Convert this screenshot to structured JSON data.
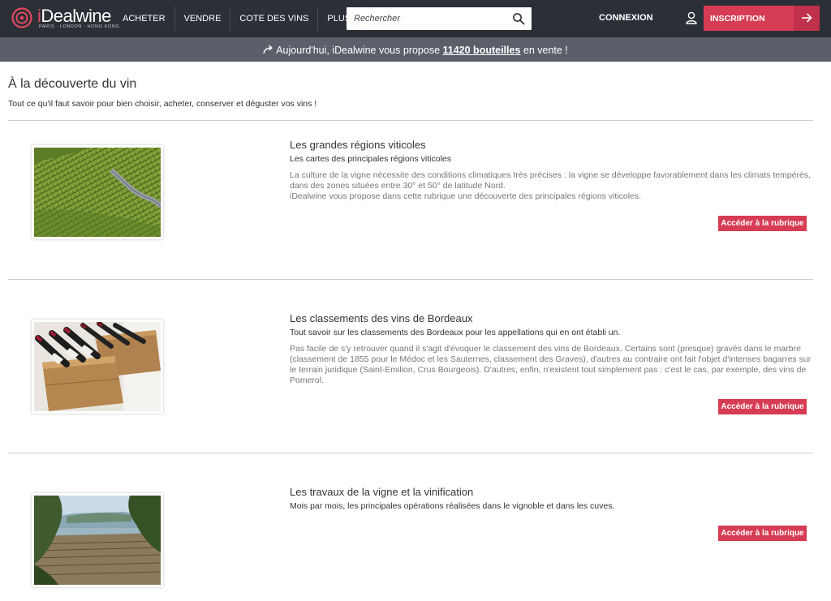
{
  "header": {
    "logo": {
      "brand_prefix": "i",
      "brand_main": "Dealwine",
      "tagline": "PARIS · LONDON · HONG KONG"
    },
    "nav": [
      {
        "label": "ACHETER"
      },
      {
        "label": "VENDRE"
      },
      {
        "label": "COTE DES VINS"
      },
      {
        "label": "PLUS..."
      }
    ],
    "search": {
      "placeholder": "Rechercher",
      "icon": "search-icon"
    },
    "connexion_label": "CONNEXION",
    "user_icon": "user-icon",
    "inscription_label": "INSCRIPTION",
    "inscription_icon": "arrow-right-icon"
  },
  "banner": {
    "prefix": "Aujourd'hui, iDealwine vous propose ",
    "count": "11420 bouteilles",
    "suffix": " en vente !"
  },
  "page": {
    "title": "À la découverte du vin",
    "subtitle": "Tout ce qu'il faut savoir pour bien choisir, acheter, conserver et déguster vos vins !"
  },
  "sections": [
    {
      "title": "Les grandes régions viticoles",
      "subtitle": "Les cartes des principales régions viticoles",
      "body": [
        "La culture de la vigne nécessite des conditions climatiques très précises : la vigne se développe favorablement dans les climats tempérés, dans des zones situées entre 30° et 50° de latitude Nord.",
        "iDealwine vous propose dans cette rubrique une découverte des principales régions viticoles."
      ],
      "button": "Accéder à la rubrique"
    },
    {
      "title": "Les classements des vins de Bordeaux",
      "subtitle": "Tout savoir sur les classements des Bordeaux pour les appellations qui en ont établi un.",
      "body": [
        "Pas facile de s'y retrouver quand il s'agit d'évoquer le classement des vins de Bordeaux. Certains sont (presque) gravés dans le marbre (classement de 1855 pour le Médoc et les Sauternes, classement des Graves), d'autres au contraire ont fait l'objet d'intenses bagarres sur le terrain juridique (Saint-Emilion, Crus Bourgeois). D'autres, enfin, n'existent tout simplement pas : c'est le cas, par exemple, des vins de Pomerol."
      ],
      "button": "Accéder à la rubrique"
    },
    {
      "title": "Les travaux de la vigne et la vinification",
      "subtitle": "Mois par mois, les principales opérations réalisées dans le vignoble et dans les cuves.",
      "body": [],
      "button": "Accéder à la rubrique"
    }
  ],
  "colors": {
    "header_bg": "#2b2f36",
    "banner_bg": "#5a5f69",
    "accent": "#d63c53"
  }
}
